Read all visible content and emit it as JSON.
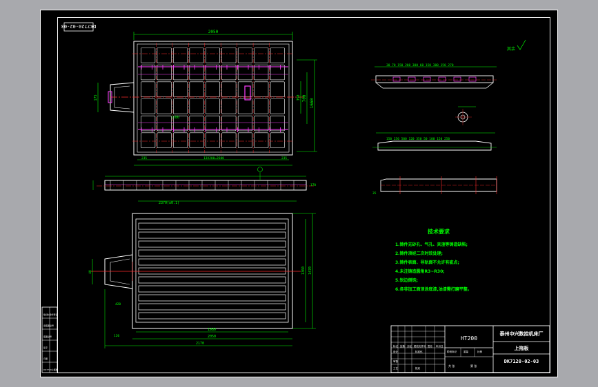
{
  "drawing": {
    "code_stamp": "DK7720-02-03",
    "material": "HT200",
    "company": "泰州中兴数控机床厂",
    "part_name": "上拖板",
    "drawing_no": "DK7120-02-03",
    "roughness_label": "其余",
    "colors": {
      "background": "#000000",
      "border": "#ffffff",
      "part": "#ffffff",
      "dimension": "#00ff00",
      "center": "#ff2a2a",
      "hidden": "#ff40ff",
      "tech": "#00ff00",
      "frame_outer": "#a8a9ad"
    }
  },
  "tech_requirements": {
    "title": "技术要求",
    "items": [
      "1.铸件无砂孔、气孔、夹渣等铸造缺陷;",
      "2.铸件须经二次时效处理;",
      "3.铸件表面、导轨面不允许有疵点;",
      "4.未注铸造圆角R3~R30;",
      "5.锐边倒钝;",
      "6.各非加工面须涂底漆,油漆需打磨平整。"
    ]
  },
  "dims": {
    "top_width": "2050",
    "top_height": "1660",
    "top_inner_v": "700",
    "top_side_v": "350",
    "top_left_small": "175",
    "top_inner_h": "1780",
    "top_bottom_a": "235",
    "top_bottom_mid": "13X200=2600",
    "top_bottom_b": "235",
    "bot_w1": "1980",
    "bot_w2": "2050",
    "bot_w3": "2170",
    "bot_h1": "1360",
    "bot_h2": "1470",
    "bot_left": "420",
    "bot_tiny": "120",
    "bot_side": "40",
    "sec_dim": "2370(±0.1)",
    "sec_right": "170",
    "right_numbers": "30 70 150 200 300 60 150 300 150 270",
    "right_second": "150 250 500 120 350 50 100 150 250",
    "right_third": "35"
  },
  "title_block": {
    "left_cells": [
      "标记",
      "处数",
      "分区",
      "更改文件号",
      "签名",
      "年月日"
    ],
    "row_design": [
      "设计",
      "标准化"
    ],
    "row_check": [
      "审核"
    ],
    "row_process": [
      "工艺",
      "批准"
    ],
    "stage": [
      "阶段标记",
      "重量",
      "比例"
    ],
    "sheet": [
      "共 张",
      "第 张"
    ]
  },
  "side_strip": [
    "借(通)用件登记",
    "旧底图总号",
    "底图总号",
    "签字",
    "日期",
    "DK7720上拖板"
  ]
}
